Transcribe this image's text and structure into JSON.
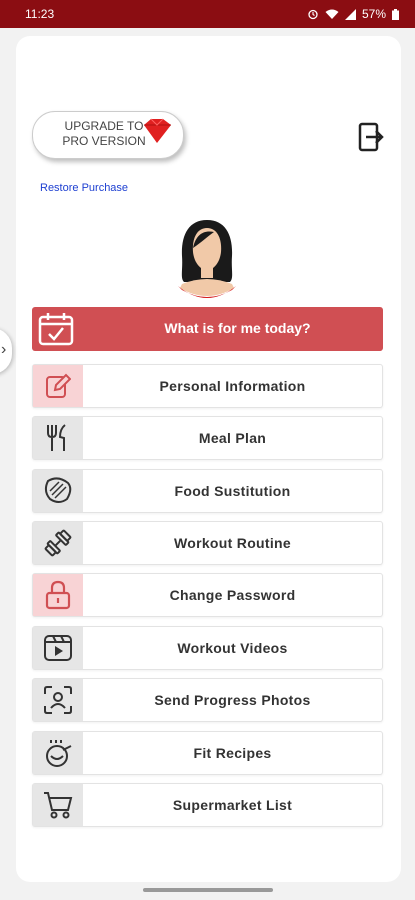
{
  "status_bar": {
    "time": "11:23",
    "battery": "57%"
  },
  "upgrade": {
    "label_line1": "UPGRADE TO",
    "label_line2": "PRO VERSION"
  },
  "restore": {
    "label": "Restore Purchase"
  },
  "today": {
    "label": "What is for me today?"
  },
  "menu": {
    "items": [
      {
        "label": "Personal Information",
        "icon": "edit-icon"
      },
      {
        "label": "Meal Plan",
        "icon": "fork-knife-icon"
      },
      {
        "label": "Food Sustitution",
        "icon": "meat-icon"
      },
      {
        "label": "Workout Routine",
        "icon": "dumbbell-icon"
      },
      {
        "label": "Change Password",
        "icon": "lock-icon"
      },
      {
        "label": "Workout Videos",
        "icon": "video-icon"
      },
      {
        "label": "Send Progress Photos",
        "icon": "face-scan-icon"
      },
      {
        "label": "Fit Recipes",
        "icon": "cooking-pot-icon"
      },
      {
        "label": "Supermarket List",
        "icon": "cart-icon"
      }
    ]
  },
  "colors": {
    "status_bar": "#8b0d12",
    "accent": "#d04f53",
    "pink_box": "#f8d3d5"
  }
}
